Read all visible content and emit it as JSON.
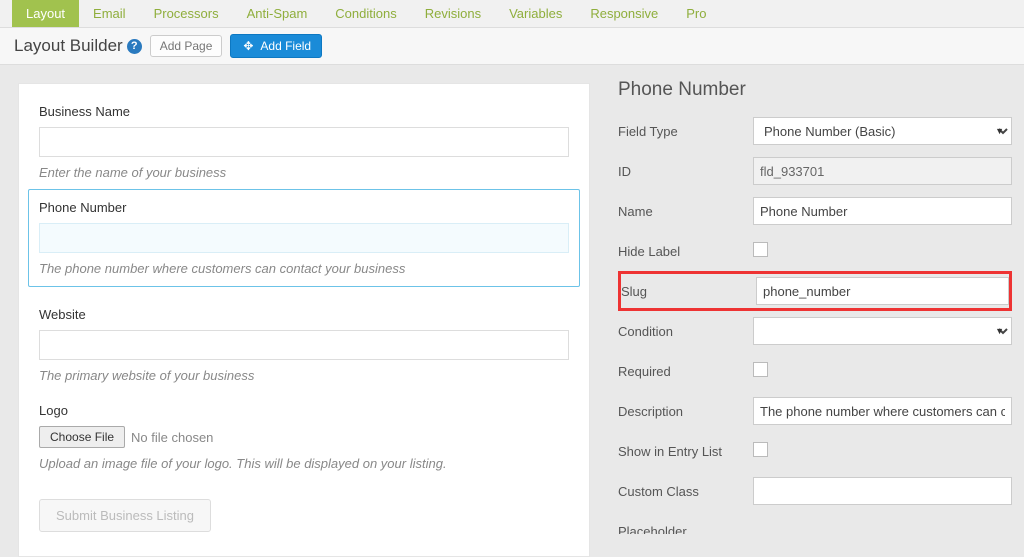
{
  "tabs": [
    "Layout",
    "Email",
    "Processors",
    "Anti-Spam",
    "Conditions",
    "Revisions",
    "Variables",
    "Responsive",
    "Pro"
  ],
  "active_tab": "Layout",
  "subhead": {
    "title": "Layout Builder",
    "add_page": "Add Page",
    "add_field": "Add Field"
  },
  "form_fields": [
    {
      "label": "Business Name",
      "value": "",
      "help": "Enter the name of your business",
      "selected": false
    },
    {
      "label": "Phone Number",
      "value": "",
      "help": "The phone number where customers can contact your business",
      "selected": true
    },
    {
      "label": "Website",
      "value": "",
      "help": "The primary website of your business",
      "selected": false
    }
  ],
  "logo": {
    "label": "Logo",
    "choose_btn": "Choose File",
    "status": "No file chosen",
    "help": "Upload an image file of your logo. This will be displayed on your listing."
  },
  "submit_label": "Submit Business Listing",
  "side_panel": {
    "title": "Phone Number",
    "rows": {
      "field_type_label": "Field Type",
      "field_type_value": "Phone Number (Basic)",
      "id_label": "ID",
      "id_value": "fld_933701",
      "name_label": "Name",
      "name_value": "Phone Number",
      "hide_label_label": "Hide Label",
      "slug_label": "Slug",
      "slug_value": "phone_number",
      "condition_label": "Condition",
      "condition_value": "",
      "required_label": "Required",
      "description_label": "Description",
      "description_value": "The phone number where customers can contact your business",
      "show_in_entry_label": "Show in Entry List",
      "custom_class_label": "Custom Class",
      "custom_class_value": "",
      "placeholder_label": "Placeholder"
    }
  }
}
